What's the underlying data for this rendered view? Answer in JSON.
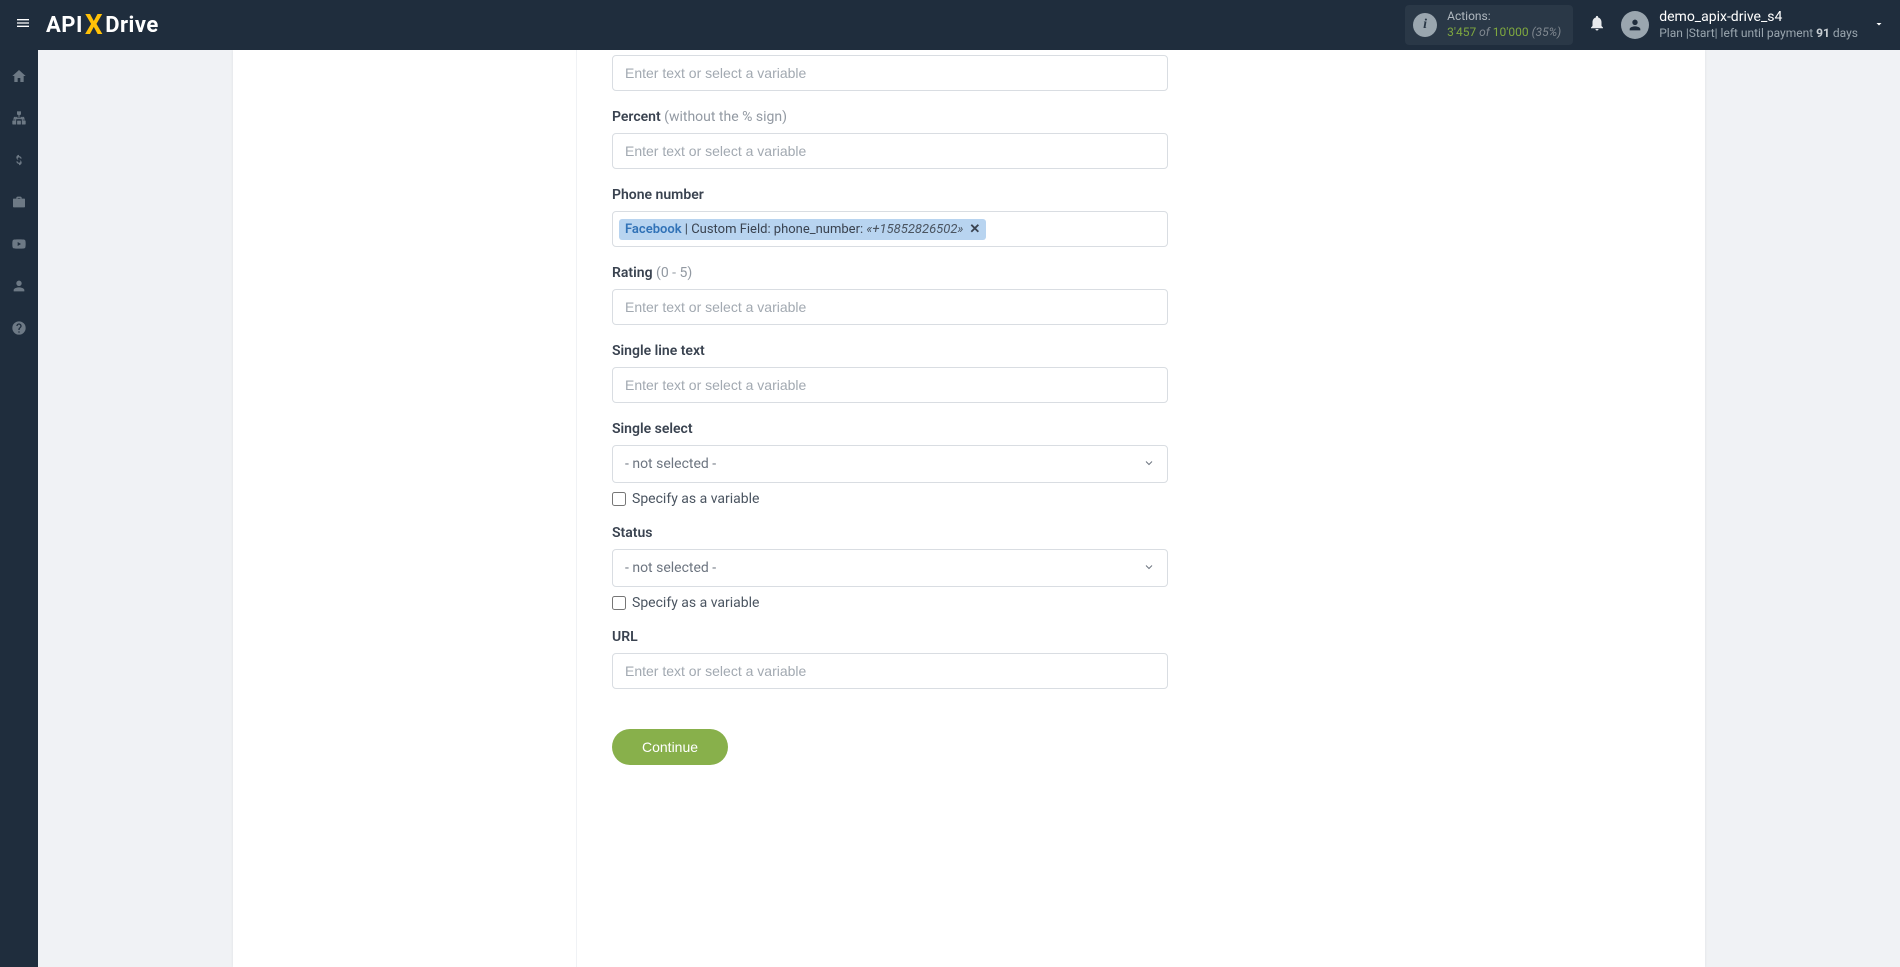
{
  "header": {
    "logo": {
      "a": "API",
      "x": "X",
      "d": "Drive"
    },
    "actions": {
      "label": "Actions:",
      "count": "3'457",
      "of": " of ",
      "max": "10'000",
      "pct": " (35%)"
    },
    "user": {
      "name": "demo_apix-drive_s4",
      "plan_prefix": "Plan |Start| left until payment ",
      "days": "91",
      "days_suffix": " days"
    }
  },
  "form": {
    "placeholder": "Enter text or select a variable",
    "percent": {
      "label": "Percent ",
      "hint": "(without the % sign)"
    },
    "phone": {
      "label": "Phone number",
      "token_source": "Facebook",
      "token_sep": " | ",
      "token_field": "Custom Field: phone_number: ",
      "token_value": "«+15852826502»"
    },
    "rating": {
      "label": "Rating ",
      "hint": "(0 - 5)"
    },
    "single_line": {
      "label": "Single line text"
    },
    "single_select": {
      "label": "Single select",
      "selected": "- not selected -",
      "specify": "Specify as a variable"
    },
    "status": {
      "label": "Status",
      "selected": "- not selected -",
      "specify": "Specify as a variable"
    },
    "url": {
      "label": "URL"
    },
    "continue": "Continue"
  }
}
